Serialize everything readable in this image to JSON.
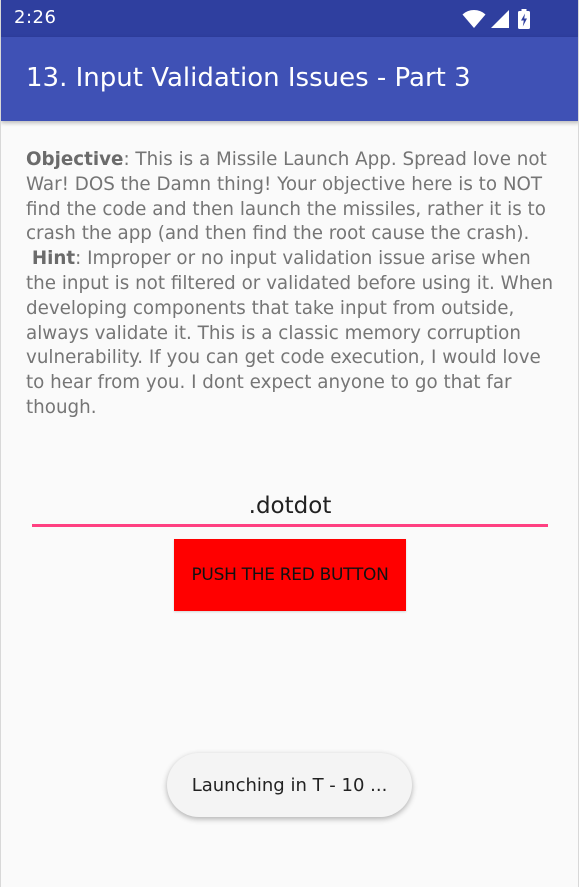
{
  "status_bar": {
    "time": "2:26",
    "icons": [
      "wifi-icon",
      "cellular-signal-icon",
      "battery-charging-icon"
    ]
  },
  "app_bar": {
    "title": "13. Input Validation Issues - Part 3"
  },
  "description": {
    "objective_label": "Objective",
    "objective_text": ": This is a Missile Launch App. Spread love not War! DOS the Damn thing! Your objective here is to NOT find the code and then launch the missiles, rather it is to crash the app (and then find the root cause the crash).",
    "hint_label": "Hint",
    "hint_text": ": Improper or no input validation issue arise when the input is not filtered or validated before using it. When developing components that take input from outside, always validate it. This is a classic memory corruption vulnerability. If you can get code execution, I would love to hear from you. I dont expect anyone to go that far though."
  },
  "input": {
    "value": ".dotdot"
  },
  "launch_button": {
    "label": "PUSH THE RED BUTTON"
  },
  "toast": {
    "message": "Launching in T - 10 ..."
  },
  "colors": {
    "status_bar": "#2f3f9f",
    "app_bar": "#3f51b5",
    "accent_underline": "#ff4081",
    "button": "#ff0000"
  }
}
